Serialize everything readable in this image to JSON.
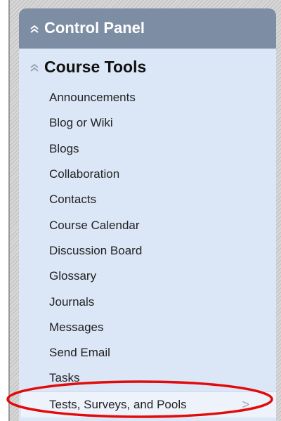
{
  "control_panel": {
    "title": "Control Panel",
    "collapse_icon": "double-chevron-up-icon"
  },
  "course_tools": {
    "title": "Course Tools",
    "collapse_icon": "double-chevron-up-icon",
    "items": [
      "Announcements",
      "Blog or Wiki",
      "Blogs",
      "Collaboration",
      "Contacts",
      "Course Calendar",
      "Discussion Board",
      "Glossary",
      "Journals",
      "Messages",
      "Send Email",
      "Tasks",
      "Tests, Surveys, and Pools"
    ],
    "highlighted_index": 12,
    "highlighted_arrow": ">"
  },
  "colors": {
    "header_bg": "#7d8da3",
    "panel_bg": "#dbe6f6",
    "annotation_ellipse": "#e20a0a"
  }
}
